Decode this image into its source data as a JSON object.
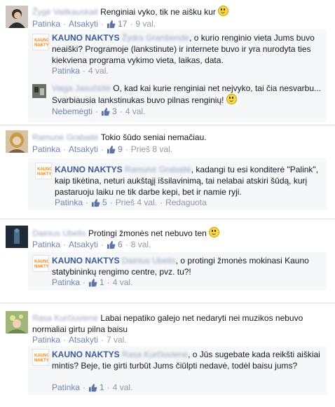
{
  "comments": [
    {
      "text": "Renginiai vyko, tik ne aišku kur",
      "meta": {
        "like": "Patinka",
        "reply": "Atsakyti",
        "likes": "17",
        "time": "9 val."
      },
      "reply": {
        "page_name": "KAUNO NAKTYS",
        "text": ", o kurio renginio vieta Jums buvo neaiški? Programoje (lankstinute) ir internete buvo ir yra nurodyta ties kiekviena programa vykimo vieta, laikas, data.",
        "meta": {
          "like": "Patinka",
          "time": "4 val."
        }
      },
      "reply2": {
        "text": "O, kad kai kurie renginiai net nejvyko, tai čia nesvarbu... Svarbiausia lankstinukas buvo pilnas renginių!",
        "meta": {
          "unlike": "Nebemėgti",
          "likes": "3",
          "time": "4 val."
        }
      }
    },
    {
      "text": "Tokio šūdo seniai nemačiau.",
      "meta": {
        "like": "Patinka",
        "reply": "Atsakyti",
        "likes": "9",
        "time": "Prieš 8 val."
      },
      "reply": {
        "page_name": "KAUNO NAKTYS",
        "text": ", kadangi tu esi konditerė \"Palink\", kaip tikėtina, neturi aukštąjį išsilavinimą, tai nelabai atskiri šūdą, kurį pastaruoju laiku ne tik darbe kepi, bet ir namie ryji.",
        "meta": {
          "like": "Patinka",
          "likes": "5",
          "time": "Prieš 4 val.",
          "edited": "Redaguota"
        }
      }
    },
    {
      "text": "Protingi žmonės net nebuvo ten",
      "meta": {
        "like": "Patinka",
        "reply": "Atsakyti",
        "likes": "6",
        "time": "8 val."
      },
      "reply": {
        "page_name": "KAUNO NAKTYS",
        "text": ", o protingi žmonės mokinasi Kauno statybininkų rengimo centre, pvz. tu?!",
        "meta": {
          "like": "Patinka",
          "likes": "1",
          "time": "4 val."
        }
      }
    },
    {
      "text": "Labai nepatiko galejo net nedaryti nei muzikos nebuvo normaliai girtu pilna baisu",
      "meta": {
        "like": "Patinka",
        "reply": "Atsakyti",
        "time": "7 val."
      },
      "reply": {
        "page_name": "KAUNO NAKTYS",
        "text": ", o Jūs sugebate kada reikšti aiškiai mintis? Beje, tie girti turbūt Jums čiūlpti nedavė, todėl baisu jums?",
        "meta": {
          "like": "Patinka",
          "likes": "1",
          "time": "4 val."
        }
      }
    }
  ],
  "colors": {
    "link": "#3b5998",
    "meta": "#9197a3",
    "reply_bg": "#f6f7f9",
    "logo_orange": "#f0892b"
  },
  "icons": [
    "thumbs-up-icon",
    "smiley-icon",
    "kauno-naktys-logo"
  ]
}
